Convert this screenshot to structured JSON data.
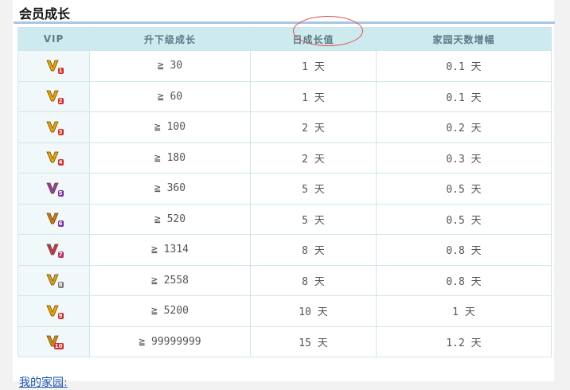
{
  "section": {
    "title": "会员成长"
  },
  "table": {
    "headers": [
      "VIP",
      "升下级成长",
      "日成长值",
      "家园天数增幅"
    ],
    "rows": [
      {
        "level": "1",
        "threshold": "≧ 30",
        "daily": "1 天",
        "boost": "0.1 天"
      },
      {
        "level": "2",
        "threshold": "≧ 60",
        "daily": "1 天",
        "boost": "0.1 天"
      },
      {
        "level": "3",
        "threshold": "≧ 100",
        "daily": "2 天",
        "boost": "0.2 天"
      },
      {
        "level": "4",
        "threshold": "≧ 180",
        "daily": "2 天",
        "boost": "0.3 天"
      },
      {
        "level": "5",
        "threshold": "≧ 360",
        "daily": "5 天",
        "boost": "0.5 天"
      },
      {
        "level": "6",
        "threshold": "≧ 520",
        "daily": "5 天",
        "boost": "0.5 天"
      },
      {
        "level": "7",
        "threshold": "≧ 1314",
        "daily": "8 天",
        "boost": "0.8 天"
      },
      {
        "level": "8",
        "threshold": "≧ 2558",
        "daily": "8 天",
        "boost": "0.8 天"
      },
      {
        "level": "9",
        "threshold": "≧ 5200",
        "daily": "10 天",
        "boost": "1 天"
      },
      {
        "level": "10",
        "threshold": "≧ 99999999",
        "daily": "15 天",
        "boost": "1.2 天"
      }
    ]
  },
  "badge_colors": {
    "1": "#e8a400",
    "2": "#e8a400",
    "3": "#e8a400",
    "4": "#e8a400",
    "5": "#8a3fb8",
    "6": "#c07a1a",
    "7": "#b8356a",
    "8": "#d4a020",
    "9": "#e8a400",
    "10": "#c98a20"
  },
  "level_tag_colors": {
    "1": "#d92b2b",
    "2": "#d92b2b",
    "3": "#d92b2b",
    "4": "#d92b2b",
    "5": "#7a2fa8",
    "6": "#7a2fa8",
    "7": "#c0306a",
    "8": "#7a7a7a",
    "9": "#d92b2b",
    "10": "#d92b2b"
  },
  "annotation": {
    "color": "#e14a4a"
  },
  "footer": {
    "link_text": "我的家园:"
  }
}
